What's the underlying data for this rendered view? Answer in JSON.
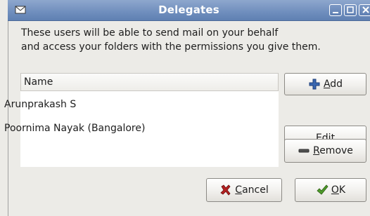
{
  "window": {
    "title": "Delegates"
  },
  "description": {
    "line1": "These users will be able to send mail on your behalf",
    "line2": "and access your folders with the permissions you give them."
  },
  "list": {
    "column_header": "Name",
    "rows": [
      "Arunprakash S",
      "Poornima Nayak (Bangalore)"
    ]
  },
  "buttons": {
    "add": {
      "mnemonic": "A",
      "rest": "dd",
      "icon": "plus-icon"
    },
    "edit": {
      "mnemonic": "E",
      "rest": "dit"
    },
    "remove": {
      "mnemonic": "R",
      "rest": "emove",
      "icon": "minus-icon"
    },
    "cancel": {
      "mnemonic": "C",
      "rest": "ancel",
      "icon": "x-icon"
    },
    "ok": {
      "mnemonic": "O",
      "rest": "K",
      "icon": "check-icon"
    }
  },
  "colors": {
    "titlebar": "#6f8ebd",
    "add_icon": "#3a67b0",
    "cancel_icon": "#b52020",
    "ok_icon": "#4e9a2a"
  }
}
